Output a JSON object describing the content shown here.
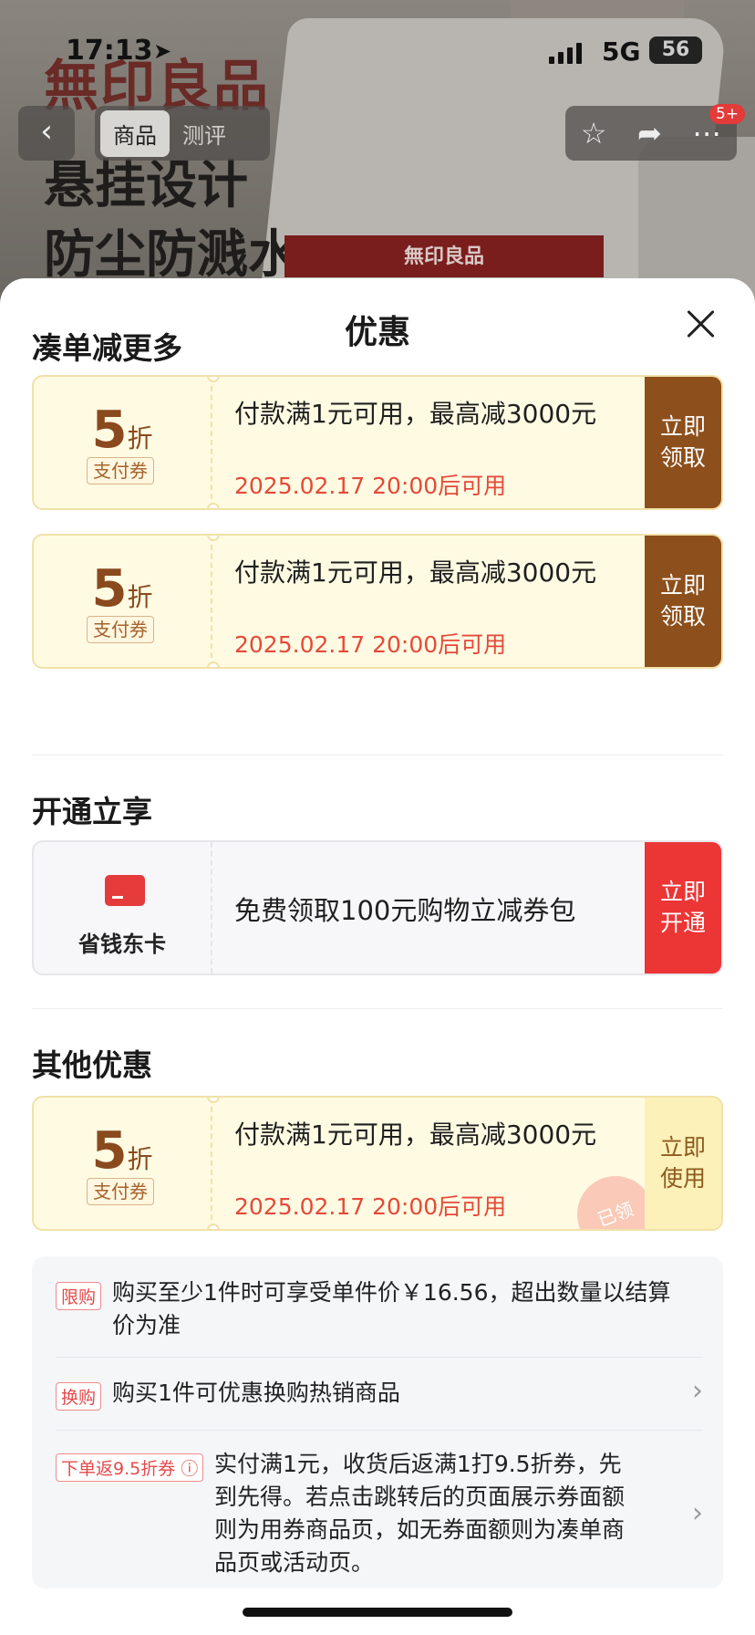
{
  "status_bar": {
    "time": "17:13",
    "network": "5G",
    "battery": "56"
  },
  "background": {
    "brand": "無印良品",
    "headline_1": "悬挂设计",
    "headline_2": "防尘防溅水",
    "product_strip": "無印良品"
  },
  "nav": {
    "tabs": [
      "商品",
      "测评"
    ],
    "badge": "5+"
  },
  "sheet": {
    "title": "优惠",
    "sections": {
      "more": "凑单减更多",
      "open": "开通立享",
      "other": "其他优惠"
    },
    "coupons": [
      {
        "amount": "5",
        "unit": "折",
        "tag": "支付券",
        "desc": "付款满1元可用，最高减3000元",
        "time": "2025.02.17 20:00后可用",
        "action": "立即领取"
      },
      {
        "amount": "5",
        "unit": "折",
        "tag": "支付券",
        "desc": "付款满1元可用，最高减3000元",
        "time": "2025.02.17 20:00后可用",
        "action": "立即领取"
      }
    ],
    "member": {
      "label": "省钱东卡",
      "desc": "免费领取100元购物立减券包",
      "action": "立即开通"
    },
    "other_coupon": {
      "amount": "5",
      "unit": "折",
      "tag": "支付券",
      "desc": "付款满1元可用，最高减3000元",
      "time": "2025.02.17 20:00后可用",
      "action": "立即使用",
      "stamp": "已领"
    },
    "info": [
      {
        "tag": "限购",
        "text": "购买至少1件时可享受单件价￥16.56，超出数量以结算价为准"
      },
      {
        "tag": "换购",
        "text": "购买1件可优惠换购热销商品"
      },
      {
        "tag": "下单返9.5折券",
        "text": "实付满1元，收货后返满1打9.5折券，先到先得。若点击跳转后的页面展示券面额则为用券商品页，如无券面额则为凑单商品页或活动页。"
      }
    ]
  }
}
